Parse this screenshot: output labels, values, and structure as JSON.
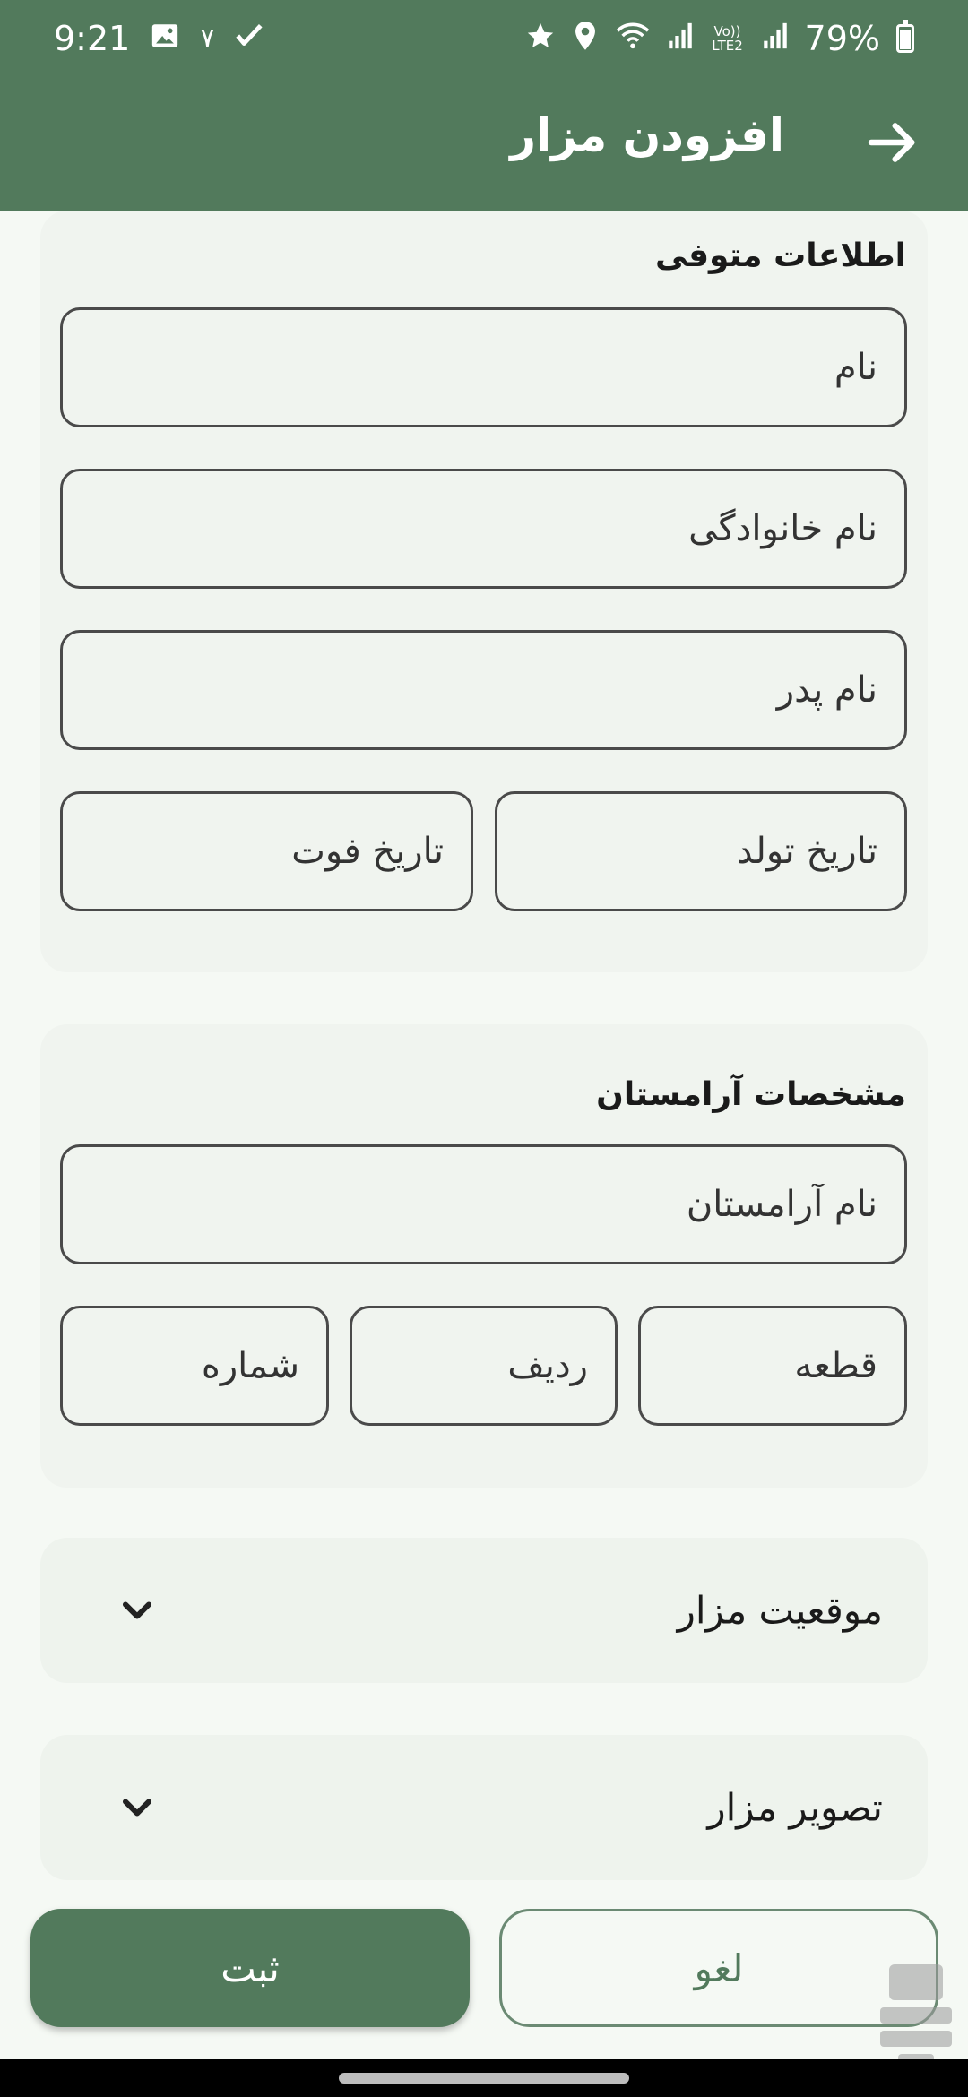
{
  "status_bar": {
    "time": "9:21",
    "battery": "79%",
    "network_label": "Vo)) LTE2",
    "extra_glyph": "٧"
  },
  "app_bar": {
    "title": "افزودن مزار",
    "back_icon": "arrow-right-icon"
  },
  "deceased_section": {
    "title": "اطلاعات متوفی",
    "fields": {
      "first_name": {
        "placeholder": "نام",
        "value": ""
      },
      "last_name": {
        "placeholder": "نام خانوادگی",
        "value": ""
      },
      "father_name": {
        "placeholder": "نام پدر",
        "value": ""
      },
      "birth_date": {
        "placeholder": "تاریخ تولد",
        "value": ""
      },
      "death_date": {
        "placeholder": "تاریخ فوت",
        "value": ""
      }
    }
  },
  "cemetery_section": {
    "title": "مشخصات آرامستان",
    "fields": {
      "cemetery_name": {
        "placeholder": "نام آرامستان",
        "value": ""
      },
      "section": {
        "placeholder": "قطعه",
        "value": ""
      },
      "row": {
        "placeholder": "ردیف",
        "value": ""
      },
      "number": {
        "placeholder": "شماره",
        "value": ""
      }
    }
  },
  "expanders": {
    "location": {
      "label": "موقعیت مزار",
      "icon": "chevron-down-icon"
    },
    "image": {
      "label": "تصویر مزار",
      "icon": "chevron-down-icon"
    }
  },
  "actions": {
    "submit_label": "ثبت",
    "cancel_label": "لغو"
  },
  "colors": {
    "primary": "#527a5c",
    "background": "#f5f9f4",
    "card": "#f0f4ef"
  }
}
